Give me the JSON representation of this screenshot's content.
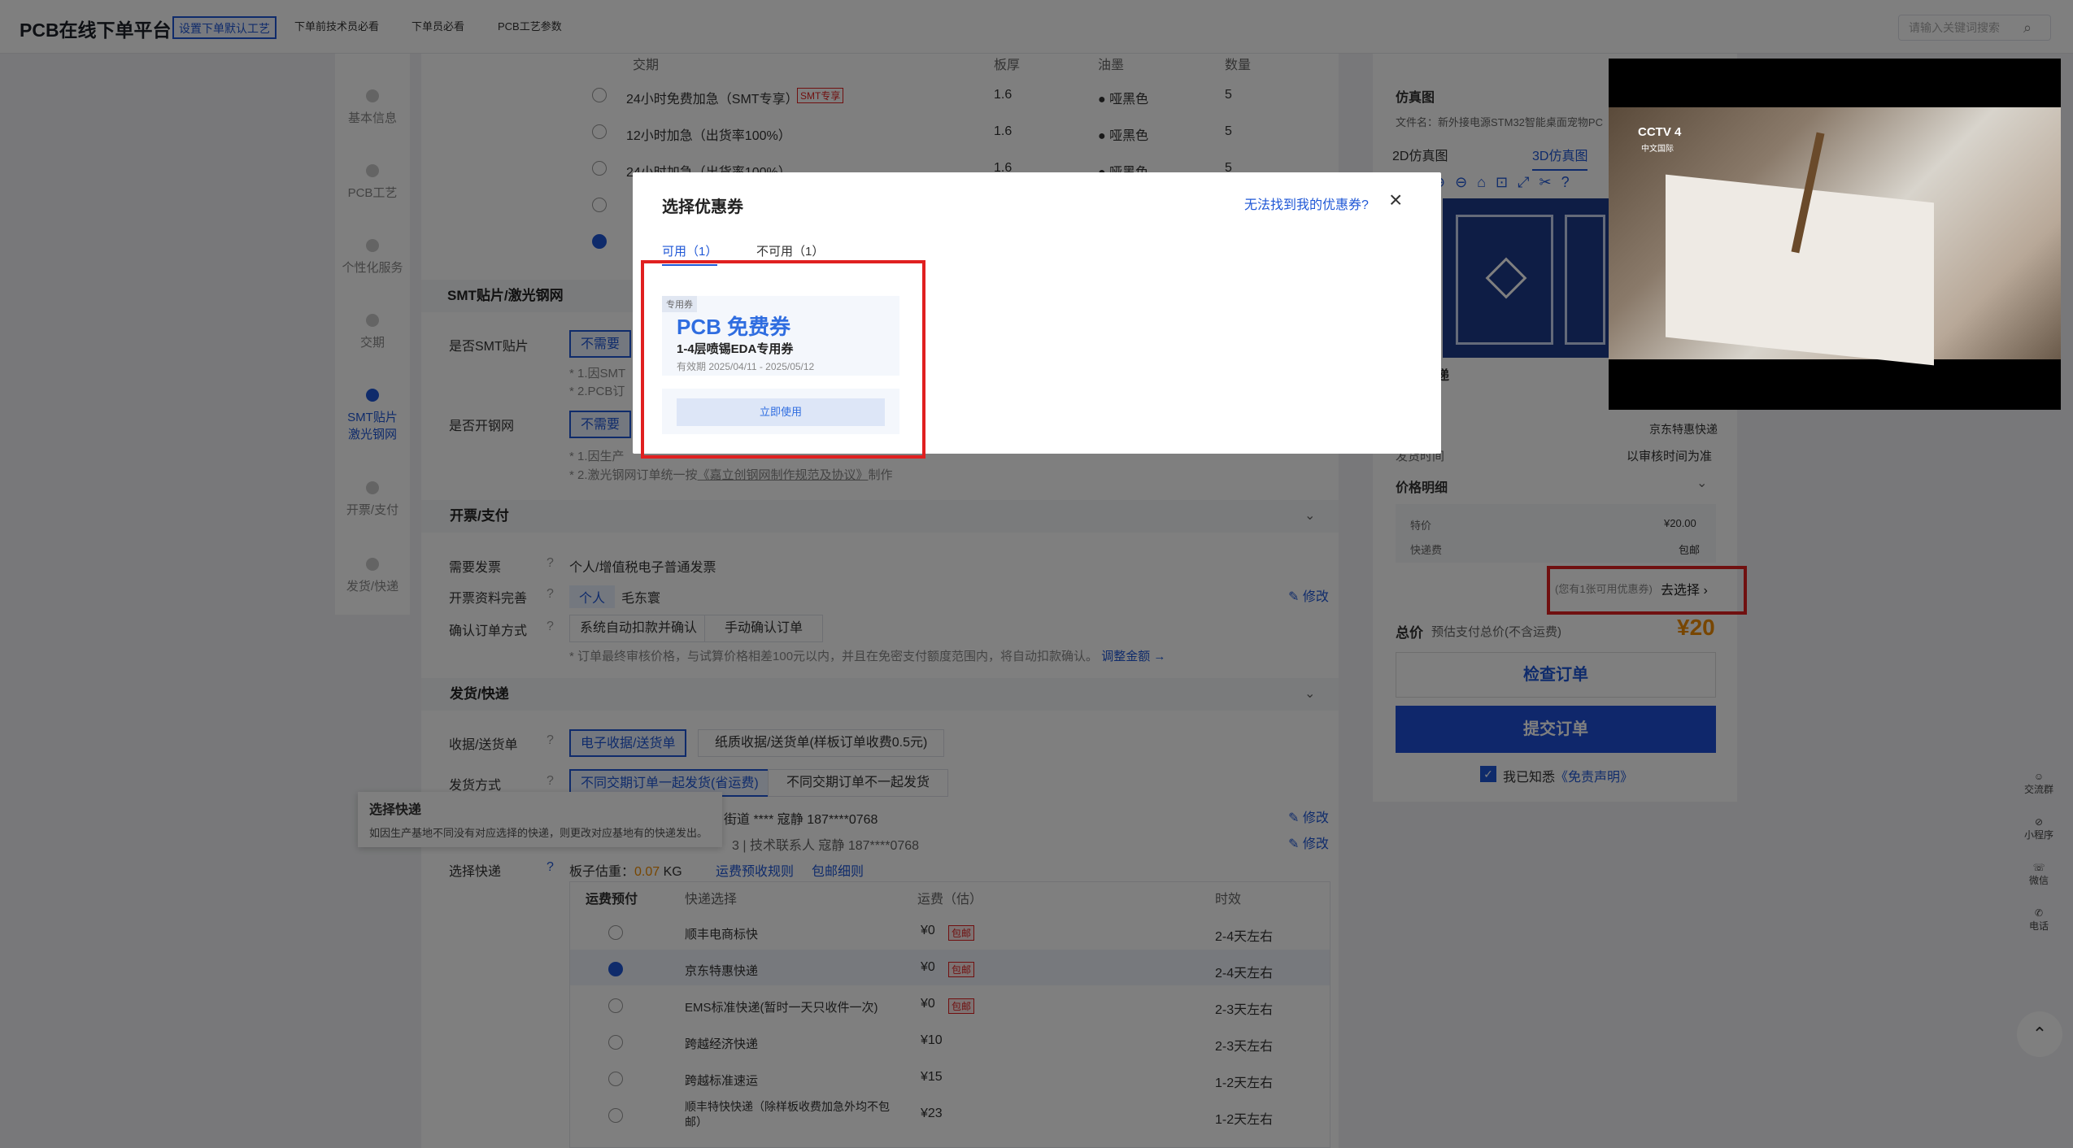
{
  "header": {
    "brand": "PCB在线下单平台",
    "crumbs": [
      "设置下单默认工艺",
      "下单前技术员必看",
      "下单员必看",
      "PCB工艺参数"
    ],
    "search_placeholder": "请输入关键词搜索"
  },
  "leftnav": [
    "基本信息",
    "PCB工艺",
    "个性化服务",
    "交期",
    "SMT贴片激光钢网",
    "开票/支付",
    "发货/快递"
  ],
  "delivery_table": {
    "headers": [
      "交期",
      "板厚",
      "油墨",
      "数量"
    ],
    "rows": [
      {
        "name": "24小时免费加急（SMT专享）",
        "tag": "SMT专享",
        "thick": "1.6",
        "ink": "哑黑色",
        "qty": "5"
      },
      {
        "name": "12小时加急（出货率100%）",
        "thick": "1.6",
        "ink": "哑黑色",
        "qty": "5"
      },
      {
        "name": "24小时加急（出货率100%）",
        "thick": "1.6",
        "ink": "哑黑色",
        "qty": "5"
      }
    ]
  },
  "smt": {
    "title": "SMT贴片/激光钢网",
    "smt_label": "是否SMT贴片",
    "no": "不需要",
    "note1": "* 1.因SMT",
    "note2": "* 2.PCB订",
    "stencil_label": "是否开钢网",
    "stencil_note1": "* 1.因生产",
    "stencil_note2": "* 2.激光钢网订单统一按",
    "stencil_link": "《嘉立创钢网制作规范及协议》",
    "stencil_suffix": "制作"
  },
  "invoice": {
    "title": "开票/支付",
    "need_label": "需要发票",
    "need_value": "个人/增值税电子普通发票",
    "info_label": "开票资料完善",
    "info_tag": "个人",
    "info_name": "毛东寰",
    "edit": "修改",
    "confirm_label": "确认订单方式",
    "auto": "系统自动扣款并确认",
    "manual": "手动确认订单",
    "note": "* 订单最终审核价格，与试算价格相差100元以内，并且在免密支付额度范围内，将自动扣款确认。",
    "adjust": "调整金额 →"
  },
  "shipping": {
    "title": "发货/快递",
    "doc_label": "收据/送货单",
    "doc_e": "电子收据/送货单",
    "doc_paper": "纸质收据/送货单(样板订单收费0.5元)",
    "method_label": "发货方式",
    "method_a": "不同交期订单一起发货(省运费)",
    "method_b": "不同交期订单不一起发货",
    "addr1": "街道  ****  寇静  187****0768",
    "addr2": "3  |  技术联系人  寇静  187****0768",
    "express_label": "选择快递",
    "weight_label": "板子估重：",
    "weight": "0.07",
    "weight_unit": "KG",
    "rule1": "运费预收规则",
    "rule2": "包邮细则",
    "tooltip_title": "选择快递",
    "tooltip_text": "如因生产基地不同没有对应选择的快递，则更改对应基地有的快递发出。",
    "table_headers": [
      "运费预付",
      "快递选择",
      "运费（估）",
      "时效"
    ],
    "rows": [
      {
        "name": "顺丰电商标快",
        "fee": "¥0",
        "tag": "包邮",
        "time": "2-4天左右",
        "on": false
      },
      {
        "name": "京东特惠快递",
        "fee": "¥0",
        "tag": "包邮",
        "time": "2-4天左右",
        "on": true
      },
      {
        "name": "EMS标准快递(暂时一天只收件一次)",
        "fee": "¥0",
        "tag": "包邮",
        "time": "2-3天左右",
        "on": false
      },
      {
        "name": "跨越经济快递",
        "fee": "¥10",
        "tag": "",
        "time": "2-3天左右",
        "on": false
      },
      {
        "name": "跨越标准速运",
        "fee": "¥15",
        "tag": "",
        "time": "1-2天左右",
        "on": false
      },
      {
        "name": "顺丰特快快递（除样板收费加急外均不包邮）",
        "fee": "¥23",
        "tag": "",
        "time": "1-2天左右",
        "on": false
      }
    ]
  },
  "right": {
    "sim_title": "仿真图",
    "file_label": "文件名：新外接电源STM32智能桌面宠物PC",
    "tab2d": "2D仿真图",
    "tab3d": "3D仿真图",
    "express_title": "递",
    "express_val": "京东特惠快递",
    "ship_time_label": "发货时间",
    "ship_time_val": "以审核时间为准",
    "price_title": "价格明细",
    "special_label": "特价",
    "special_val": "¥20.00",
    "fee_label": "快递费",
    "fee_val": "包邮",
    "coupon_hint": "(您有1张可用优惠券)",
    "coupon_go": "去选择",
    "total_label": "总价",
    "total_note": "预估支付总价(不含运费)",
    "total": "¥20",
    "check": "检查订单",
    "submit": "提交订单",
    "agree": "我已知悉",
    "disclaimer": "《免责声明》"
  },
  "modal": {
    "title": "选择优惠券",
    "help": "无法找到我的优惠券?",
    "tab_ok": "可用（1）",
    "tab_no": "不可用（1）",
    "badge": "专用券",
    "coupon_title": "PCB 免费券",
    "coupon_sub": "1-4层喷锡EDA专用券",
    "coupon_valid": "有效期 2025/04/11 - 2025/05/12",
    "use": "立即使用"
  },
  "video": {
    "channel": "CCTV 4",
    "sub": "中文国际"
  },
  "float": [
    "交流群",
    "小程序",
    "微信",
    "电话"
  ]
}
